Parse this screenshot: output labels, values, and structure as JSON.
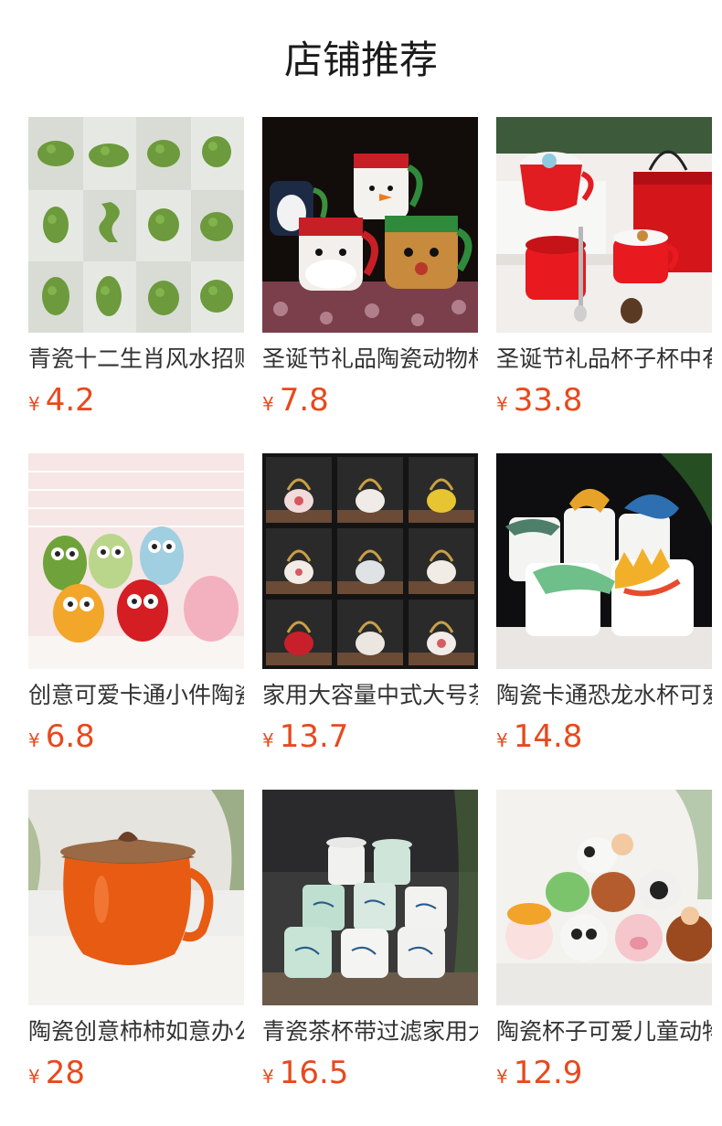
{
  "section": {
    "title": "店铺推荐",
    "accent_color": "#e8491d"
  },
  "products": [
    {
      "name": "青瓷十二生肖风水招财",
      "currency": "¥",
      "price": "4.2",
      "image": "green-zodiac-figurines"
    },
    {
      "name": "圣诞节礼品陶瓷动物杯",
      "currency": "¥",
      "price": "7.8",
      "image": "christmas-character-mugs"
    },
    {
      "name": "圣诞节礼品杯子杯中有",
      "currency": "¥",
      "price": "33.8",
      "image": "red-christmas-gift-cups"
    },
    {
      "name": "创意可爱卡通小件陶瓷",
      "currency": "¥",
      "price": "6.8",
      "image": "ceramic-owl-figurines"
    },
    {
      "name": "家用大容量中式大号茶",
      "currency": "¥",
      "price": "13.7",
      "image": "chinese-teapot-set-grid"
    },
    {
      "name": "陶瓷卡通恐龙水杯可爱",
      "currency": "¥",
      "price": "14.8",
      "image": "dinosaur-mugs"
    },
    {
      "name": "陶瓷创意柿柿如意办公",
      "currency": "¥",
      "price": "28",
      "image": "persimmon-mug"
    },
    {
      "name": "青瓷茶杯带过滤家用大",
      "currency": "¥",
      "price": "16.5",
      "image": "celadon-tea-cups"
    },
    {
      "name": "陶瓷杯子可爱儿童动物",
      "currency": "¥",
      "price": "12.9",
      "image": "animal-kids-mugs"
    }
  ]
}
